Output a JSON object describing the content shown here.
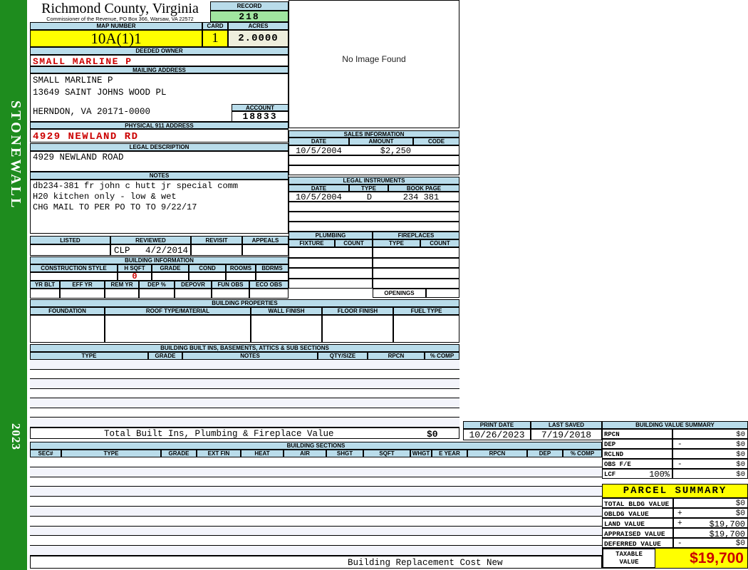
{
  "sidebar": {
    "district": "STONEWALL",
    "year": "2023"
  },
  "header": {
    "county": "Richmond County, Virginia",
    "commissioner": "Commissioner of the Revenue, PO Box 366, Warsaw, VA 22572",
    "record_label": "RECORD",
    "record": "218",
    "map_number_label": "MAP NUMBER",
    "map_number": "10A(1)1",
    "card_label": "CARD",
    "card": "1",
    "acres_label": "ACRES",
    "acres": "2.0000"
  },
  "owner": {
    "deeded_owner_label": "DEEDED OWNER",
    "deeded_owner": "SMALL MARLINE P",
    "mailing_address_label": "MAILING ADDRESS",
    "mailing_line1": "SMALL MARLINE P",
    "mailing_line2": "13649 SAINT JOHNS WOOD PL",
    "mailing_line3": "HERNDON, VA 20171-0000",
    "account_label": "ACCOUNT",
    "account": "18833",
    "physical_address_label": "PHYSICAL 911 ADDRESS",
    "physical_address": "4929 NEWLAND RD",
    "legal_description_label": "LEGAL DESCRIPTION",
    "legal_description": "4929 NEWLAND ROAD",
    "notes_label": "NOTES",
    "notes_line1": "db234-381 fr john c hutt jr special comm",
    "notes_line2": "H20 kitchen only - low & wet",
    "notes_line3": "CHG MAIL TO PER PO TO TO 9/22/17"
  },
  "image_panel": {
    "message": "No Image Found"
  },
  "sales": {
    "title": "SALES INFORMATION",
    "col_date": "DATE",
    "col_amount": "AMOUNT",
    "col_code": "CODE",
    "row1": {
      "date": "10/5/2004",
      "amount": "$2,250",
      "code": ""
    }
  },
  "legal_instruments": {
    "title": "LEGAL INSTRUMENTS",
    "col_date": "DATE",
    "col_type": "TYPE",
    "col_bookpage": "BOOK PAGE",
    "row1": {
      "date": "10/5/2004",
      "type": "D",
      "bookpage": "234 381"
    }
  },
  "plumbing": {
    "title": "PLUMBING",
    "col_fixture": "FIXTURE",
    "col_count": "COUNT"
  },
  "fireplaces": {
    "title": "FIREPLACES",
    "col_type": "TYPE",
    "col_count": "COUNT",
    "openings_label": "OPENINGS"
  },
  "review": {
    "col_listed": "LISTED",
    "col_reviewed": "REVIEWED",
    "col_revisit": "REVISIT",
    "col_appeals": "APPEALS",
    "reviewed_by": "CLP",
    "reviewed_date": "4/2/2014"
  },
  "building_information": {
    "title": "BUILDING INFORMATION",
    "cols1": [
      "CONSTRUCTION STYLE",
      "H SQFT",
      "GRADE",
      "COND",
      "ROOMS",
      "BDRMS"
    ],
    "hsqft_value": "0",
    "cols2": [
      "YR BLT",
      "EFF YR",
      "REM YR",
      "DEP %",
      "DEPOVR",
      "FUN OBS",
      "ECO OBS"
    ]
  },
  "building_properties": {
    "title": "BUILDING PROPERTIES",
    "cols": [
      "FOUNDATION",
      "ROOF TYPE/MATERIAL",
      "WALL FINISH",
      "FLOOR FINISH",
      "FUEL TYPE"
    ]
  },
  "built_ins": {
    "title": "BUILDING BUILT INS, BASEMENTS, ATTICS & SUB SECTIONS",
    "cols": [
      "TYPE",
      "GRADE",
      "NOTES",
      "QTY/SIZE",
      "RPCN",
      "% COMP"
    ],
    "total_label": "Total Built Ins, Plumbing & Fireplace Value",
    "total_value": "$0"
  },
  "print_info": {
    "print_date_label": "PRINT DATE",
    "print_date": "10/26/2023",
    "last_saved_label": "LAST SAVED",
    "last_saved": "7/19/2018"
  },
  "building_value_summary": {
    "title": "BUILDING VALUE SUMMARY",
    "rows": [
      {
        "label": "RPCN",
        "op": "",
        "value": "$0"
      },
      {
        "label": "DEP",
        "op": "-",
        "value": "$0"
      },
      {
        "label": "RCLND",
        "op": "",
        "value": "$0"
      },
      {
        "label": "OBS F/E",
        "op": "-",
        "value": "$0"
      },
      {
        "label": "LCF",
        "pct": "100%",
        "op": "",
        "value": "$0"
      }
    ]
  },
  "building_sections": {
    "title": "BUILDING SECTIONS",
    "cols": [
      "SEC#",
      "TYPE",
      "GRADE",
      "EXT FIN",
      "HEAT",
      "AIR",
      "SHGT",
      "SQFT",
      "WHGT",
      "E YEAR",
      "RPCN",
      "DEP",
      "% COMP"
    ]
  },
  "parcel_summary": {
    "title": "PARCEL SUMMARY",
    "rows": [
      {
        "label": "TOTAL BLDG VALUE",
        "op": "",
        "value": "$0"
      },
      {
        "label": "OBLDG VALUE",
        "op": "+",
        "value": "$0"
      },
      {
        "label": "LAND VALUE",
        "op": "+",
        "value": "$19,700"
      },
      {
        "label": "APPRAISED VALUE",
        "op": "",
        "value": "$19,700"
      },
      {
        "label": "DEFERRED VALUE",
        "op": "-",
        "value": "$0"
      }
    ],
    "taxable_label": "TAXABLE VALUE",
    "taxable_value": "$19,700"
  },
  "footer": {
    "text": "Building Replacement Cost New"
  },
  "colors": {
    "sidebar_green": "#1e8c1e",
    "header_blue": "#b9dcea",
    "record_green": "#a0e6a0",
    "highlight_yellow": "#ffff00",
    "acres_cream": "#eeeedd",
    "alert_red": "#cc0000"
  }
}
